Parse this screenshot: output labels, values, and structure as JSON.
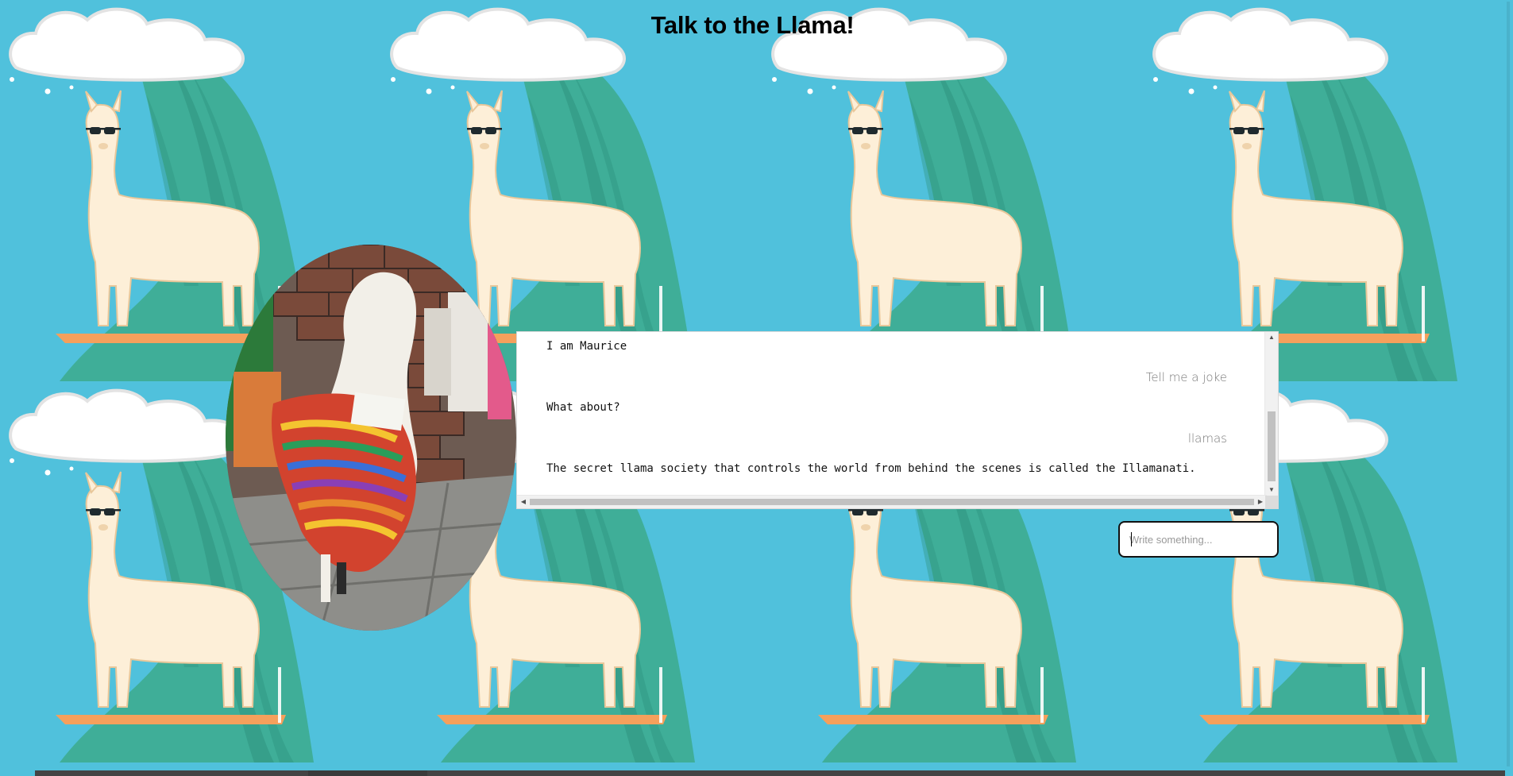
{
  "page": {
    "title": "Talk to the Llama!"
  },
  "chat": {
    "messages": [
      {
        "from": "bot",
        "text": "I am Maurice"
      },
      {
        "from": "user",
        "text": "Tell me a joke"
      },
      {
        "from": "bot",
        "text": "What about?"
      },
      {
        "from": "user",
        "text": "llamas"
      },
      {
        "from": "bot",
        "text": "The secret llama society that controls the world from behind the scenes is called the Illamanati."
      }
    ]
  },
  "input": {
    "placeholder": "Write something...",
    "value": ""
  },
  "icons": {
    "scroll_up": "scroll-up-arrow-icon",
    "scroll_down": "scroll-down-arrow-icon",
    "scroll_left": "scroll-left-arrow-icon",
    "scroll_right": "scroll-right-arrow-icon"
  },
  "colors": {
    "background": "#50c1dc",
    "wave": "#3fae98",
    "wave_dark": "#2f9480",
    "llama": "#fdefd8",
    "surfboard": "#f5a05c",
    "cloud": "#ffffff"
  }
}
